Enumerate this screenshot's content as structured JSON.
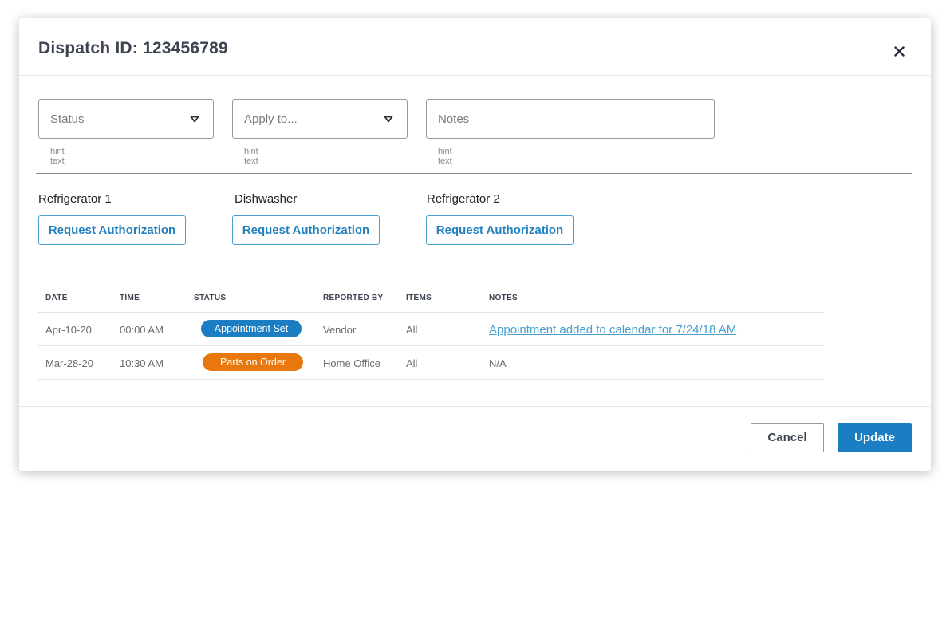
{
  "modal": {
    "title": "Dispatch ID: 123456789",
    "close_icon": "close-icon"
  },
  "fields": [
    {
      "label": "Status",
      "hint": "hint text",
      "type": "dropdown"
    },
    {
      "label": "Apply to...",
      "hint": "hint text",
      "type": "dropdown"
    },
    {
      "label": "Notes",
      "hint": "hint text",
      "type": "text"
    }
  ],
  "appliances": [
    {
      "name": "Refrigerator 1",
      "button_label": "Request Authorization"
    },
    {
      "name": "Dishwasher",
      "button_label": "Request Authorization"
    },
    {
      "name": "Refrigerator 2",
      "button_label": "Request Authorization"
    }
  ],
  "table": {
    "headers": [
      "DATE",
      "TIME",
      "STATUS",
      "REPORTED BY",
      "ITEMS",
      "NOTES"
    ],
    "rows": [
      {
        "date": "Apr-10-20",
        "time": "00:00 AM",
        "status": "Appointment Set",
        "status_color": "#1b7ec2",
        "reported_by": "Vendor",
        "items": "All",
        "notes": "Appointment added to calendar for 7/24/18 AM"
      },
      {
        "date": "Mar-28-20",
        "time": "10:30 AM",
        "status": "Parts on Order",
        "status_color": "#e8770d",
        "reported_by": "Home Office",
        "items": "All",
        "notes": "N/A"
      }
    ]
  },
  "footer": {
    "cancel_label": "Cancel",
    "update_label": "Update"
  },
  "colors": {
    "accent": "#1b7ec2",
    "link": "#4a9fd1",
    "warning": "#e8770d"
  }
}
